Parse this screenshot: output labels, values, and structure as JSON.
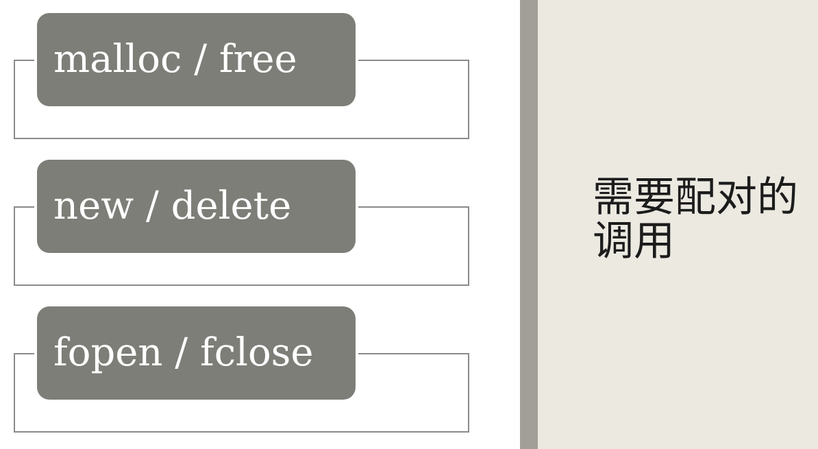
{
  "items": [
    {
      "label": "malloc / free"
    },
    {
      "label": "new / delete"
    },
    {
      "label": "fopen / fclose"
    }
  ],
  "side_panel": {
    "text": "需要配对的调用"
  },
  "colors": {
    "pill": "#7e7e78",
    "frame": "#8a8a8a",
    "divider": "#a29f99",
    "panel": "#ece9e1",
    "text_dark": "#1c1c1c"
  }
}
